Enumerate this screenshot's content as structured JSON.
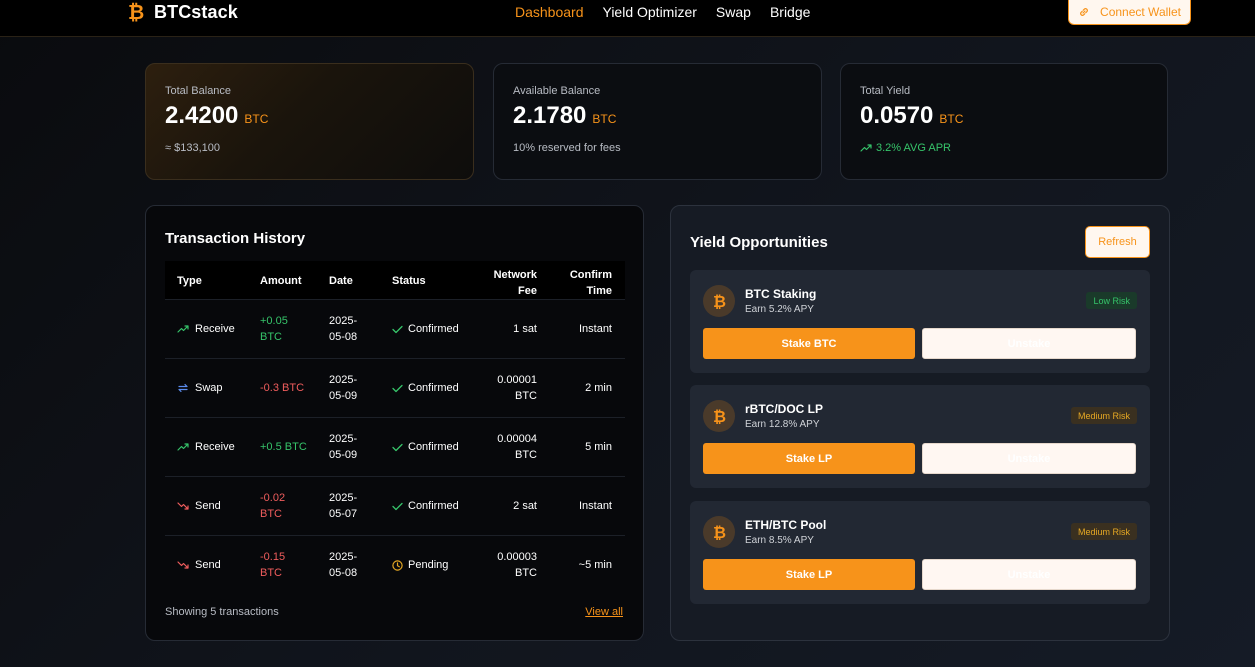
{
  "nav": {
    "brand": "BTCstack",
    "links": [
      "Dashboard",
      "Yield Optimizer",
      "Swap",
      "Bridge"
    ],
    "active_index": 0,
    "connect_label": "Connect Wallet"
  },
  "stats": [
    {
      "label": "Total Balance",
      "value": "2.4200",
      "unit": "BTC",
      "sub": "≈ $133,100"
    },
    {
      "label": "Available Balance",
      "value": "2.1780",
      "unit": "BTC",
      "sub": "10% reserved for fees"
    },
    {
      "label": "Total Yield",
      "value": "0.0570",
      "unit": "BTC",
      "sub": "3.2% AVG APR"
    }
  ],
  "transactions": {
    "title": "Transaction History",
    "headers": {
      "type": "Type",
      "amount": "Amount",
      "date": "Date",
      "status": "Status",
      "fee_line1": "Network",
      "fee_line2": "Fee",
      "time_line1": "Confirm",
      "time_line2": "Time"
    },
    "rows": [
      {
        "type": "Receive",
        "amount_l1": "+0.05",
        "amount_l2": "BTC",
        "date_l1": "2025-",
        "date_l2": "05-08",
        "status": "Confirmed",
        "fee_l1": "1 sat",
        "fee_l2": "",
        "time": "Instant"
      },
      {
        "type": "Swap",
        "amount_l1": "-0.3 BTC",
        "amount_l2": "",
        "date_l1": "2025-",
        "date_l2": "05-09",
        "status": "Confirmed",
        "fee_l1": "0.00001",
        "fee_l2": "BTC",
        "time": "2 min"
      },
      {
        "type": "Receive",
        "amount_l1": "+0.5 BTC",
        "amount_l2": "",
        "date_l1": "2025-",
        "date_l2": "05-09",
        "status": "Confirmed",
        "fee_l1": "0.00004",
        "fee_l2": "BTC",
        "time": "5 min"
      },
      {
        "type": "Send",
        "amount_l1": "-0.02",
        "amount_l2": "BTC",
        "date_l1": "2025-",
        "date_l2": "05-07",
        "status": "Confirmed",
        "fee_l1": "2 sat",
        "fee_l2": "",
        "time": "Instant"
      },
      {
        "type": "Send",
        "amount_l1": "-0.15",
        "amount_l2": "BTC",
        "date_l1": "2025-",
        "date_l2": "05-08",
        "status": "Pending",
        "fee_l1": "0.00003",
        "fee_l2": "BTC",
        "time": "~5 min"
      }
    ],
    "footer": "Showing 5 transactions",
    "view_all": "View all"
  },
  "yield": {
    "title": "Yield Opportunities",
    "refresh_label": "Refresh",
    "opportunities": [
      {
        "name": "BTC Staking",
        "apy": "Earn 5.2% APY",
        "risk": "Low Risk",
        "stake_label": "Stake BTC",
        "unstake_label": "Unstake"
      },
      {
        "name": "rBTC/DOC LP",
        "apy": "Earn 12.8% APY",
        "risk": "Medium Risk",
        "stake_label": "Stake LP",
        "unstake_label": "Unstake"
      },
      {
        "name": "ETH/BTC Pool",
        "apy": "Earn 8.5% APY",
        "risk": "Medium Risk",
        "stake_label": "Stake LP",
        "unstake_label": "Unstake"
      }
    ]
  },
  "colors": {
    "accent": "#f7931a",
    "positive": "#36c46a",
    "negative": "#f05d5d",
    "pending": "#e6a823"
  }
}
